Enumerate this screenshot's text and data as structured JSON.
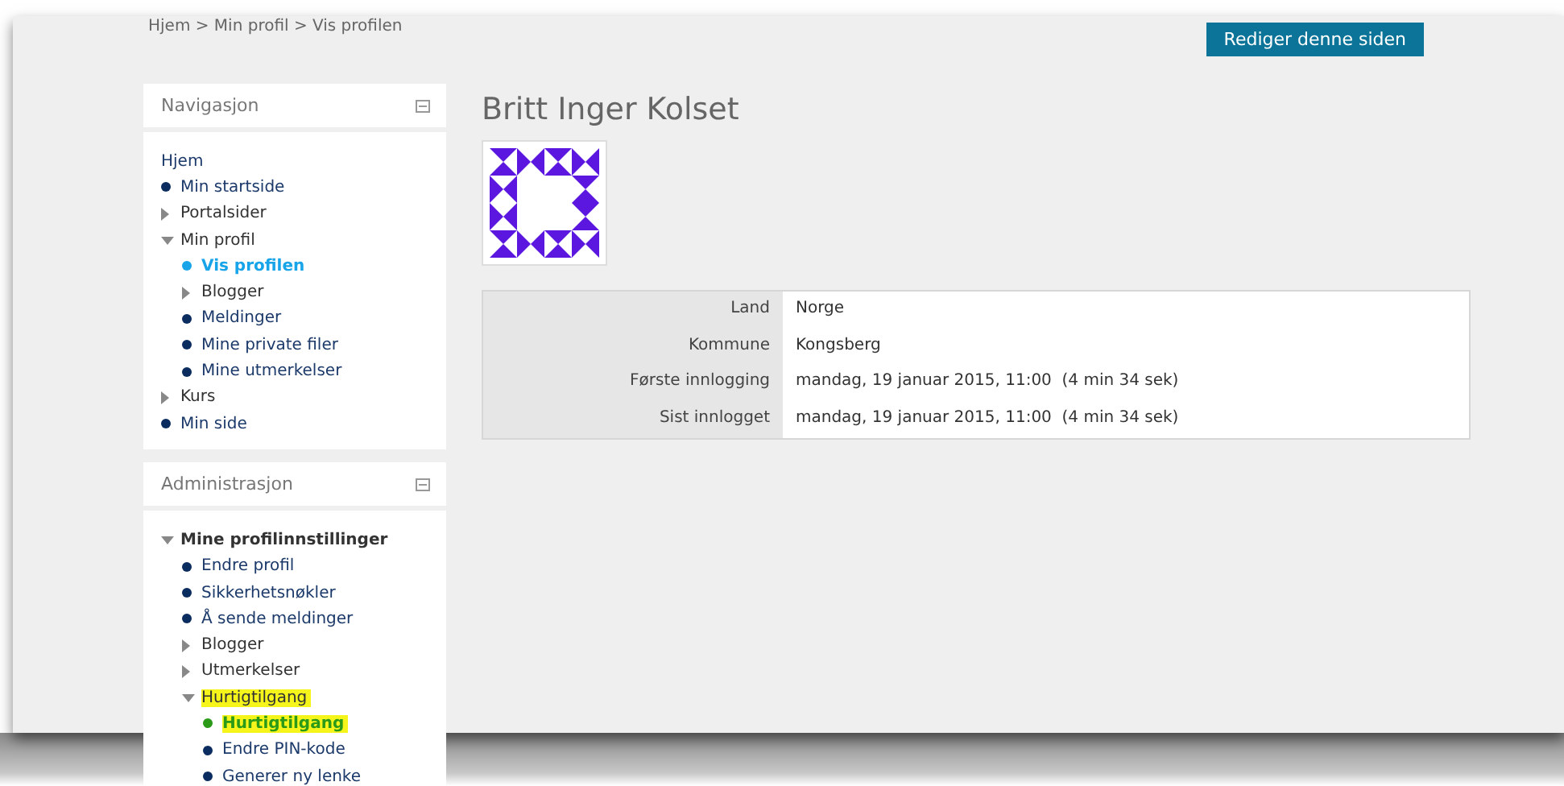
{
  "breadcrumb": [
    "Hjem",
    "Min profil",
    "Vis profilen"
  ],
  "breadcrumb_separator": ">",
  "edit_button": "Rediger denne siden",
  "blocks": [
    {
      "title": "Navigasjon",
      "items": [
        {
          "label": "Hjem",
          "kind": "plain",
          "selected": false,
          "highlighted": false
        },
        {
          "label": "Min startside",
          "kind": "leaf",
          "selected": false,
          "highlighted": false
        },
        {
          "label": "Portalsider",
          "kind": "branch",
          "expanded": false,
          "selected": false,
          "highlighted": false
        },
        {
          "label": "Min profil",
          "kind": "branch",
          "expanded": true,
          "selected": false,
          "highlighted": false,
          "children": [
            {
              "label": "Vis profilen",
              "kind": "leaf",
              "selected": true,
              "highlighted": false
            },
            {
              "label": "Blogger",
              "kind": "branch",
              "expanded": false,
              "selected": false,
              "highlighted": false
            },
            {
              "label": "Meldinger",
              "kind": "leaf",
              "selected": false,
              "highlighted": false
            },
            {
              "label": "Mine private filer",
              "kind": "leaf",
              "selected": false,
              "highlighted": false
            },
            {
              "label": "Mine utmerkelser",
              "kind": "leaf",
              "selected": false,
              "highlighted": false
            }
          ]
        },
        {
          "label": "Kurs",
          "kind": "branch",
          "expanded": false,
          "selected": false,
          "highlighted": false
        },
        {
          "label": "Min side",
          "kind": "leaf",
          "selected": false,
          "highlighted": false
        }
      ]
    },
    {
      "title": "Administrasjon",
      "items": [
        {
          "label": "Mine profilinnstillinger",
          "kind": "section",
          "expanded": true,
          "selected": false,
          "highlighted": false,
          "children": [
            {
              "label": "Endre profil",
              "kind": "leaf",
              "selected": false,
              "highlighted": false
            },
            {
              "label": "Sikkerhetsnøkler",
              "kind": "leaf",
              "selected": false,
              "highlighted": false
            },
            {
              "label": "Å sende meldinger",
              "kind": "leaf",
              "selected": false,
              "highlighted": false
            },
            {
              "label": "Blogger",
              "kind": "branch",
              "expanded": false,
              "selected": false,
              "highlighted": false
            },
            {
              "label": "Utmerkelser",
              "kind": "branch",
              "expanded": false,
              "selected": false,
              "highlighted": false
            },
            {
              "label": "Hurtigtilgang",
              "kind": "branch",
              "expanded": true,
              "selected": false,
              "highlighted": true,
              "children": [
                {
                  "label": "Hurtigtilgang",
                  "kind": "leaf",
                  "selected": true,
                  "highlighted": true
                },
                {
                  "label": "Endre PIN-kode",
                  "kind": "leaf",
                  "selected": false,
                  "highlighted": false
                },
                {
                  "label": "Generer ny lenke",
                  "kind": "leaf",
                  "selected": false,
                  "highlighted": false
                }
              ]
            }
          ]
        }
      ]
    }
  ],
  "profile": {
    "name": "Britt Inger Kolset",
    "fields": [
      {
        "label": "Land",
        "value": "Norge"
      },
      {
        "label": "Kommune",
        "value": "Kongsberg"
      },
      {
        "label": "Første innlogging",
        "value": "mandag, 19 januar 2015, 11:00  (4 min 34 sek)"
      },
      {
        "label": "Sist innlogget",
        "value": "mandag, 19 januar 2015, 11:00  (4 min 34 sek)"
      }
    ]
  }
}
